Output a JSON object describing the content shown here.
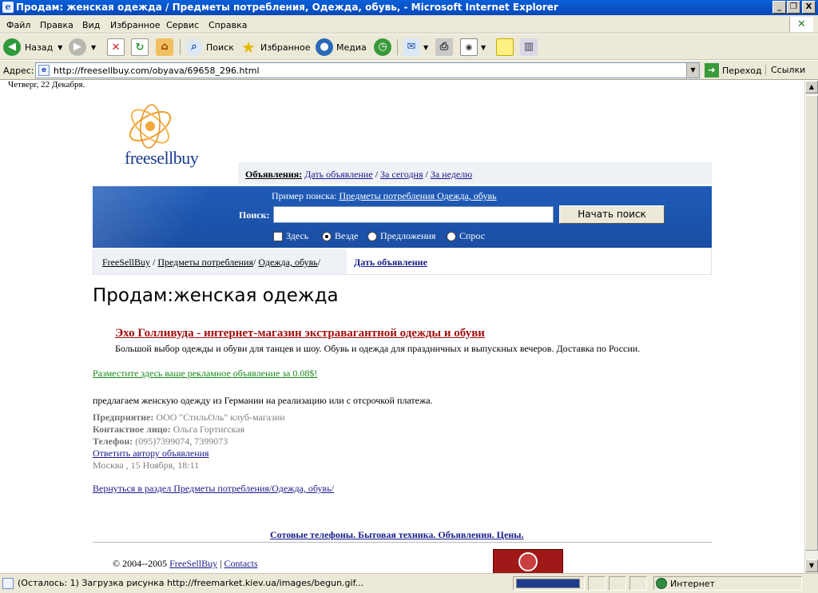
{
  "window": {
    "title": "Продам: женская одежда / Предметы потребления, Одежда, обувь, - Microsoft Internet Explorer",
    "min": "_",
    "max": "❐",
    "close": "X"
  },
  "menu": [
    "Файл",
    "Правка",
    "Вид",
    "Избранное",
    "Сервис",
    "Справка"
  ],
  "toolbar": {
    "back": "Назад",
    "search": "Поиск",
    "favorites": "Избранное",
    "media": "Медиа"
  },
  "address": {
    "label": "Адрес:",
    "url": "http://freesellbuy.com/obyava/69658_296.html",
    "go": "Переход",
    "links": "Ссылки"
  },
  "page": {
    "date": "Четверг, 22 Декабря.",
    "logo": "freesellbuy",
    "ads_bar": {
      "label": "Объявления:",
      "links": [
        "Дать объявление",
        "За сегодня",
        "За неделю"
      ],
      "sep": "/"
    },
    "search": {
      "example_label": "Пример поиска:",
      "example_link": "Предметы потребления Одежда, обувь",
      "label": "Поиск:",
      "value": "",
      "button": "Начать поиск",
      "options": [
        {
          "label": "Здесь",
          "type": "checkbox",
          "checked": false
        },
        {
          "label": "Везде",
          "type": "radio",
          "checked": true
        },
        {
          "label": "Предложения",
          "type": "radio",
          "checked": false
        },
        {
          "label": "Спрос",
          "type": "radio",
          "checked": false
        }
      ]
    },
    "breadcrumb": {
      "items": [
        "FreeSellBuy",
        "Предметы потребления",
        "Одежда, обувь"
      ],
      "give_ad": "Дать объявление"
    },
    "heading": "Продам:женская одежда",
    "ad": {
      "title": "Эхо Голливуда - интернет-магазин экстравагантной одежды и обуви",
      "text": "Большой выбор одежды и обуви для танцев и шоу. Обувь и одежда для праздничных и выпускных вечеров. Доставка по России."
    },
    "place_ad": "Разместите здесь ваше рекламное объявление за 0.08$!",
    "body": "предлагаем женскую одежду из Германии на реализацию или с отсрочкой платежа.",
    "details": {
      "company_label": "Предприятие:",
      "company": "ООО \"СтильОль\" клуб-магазин",
      "contact_label": "Контактное лицо:",
      "contact": "Ольга Гортигская",
      "phone_label": "Телефон:",
      "phone": "(095)7399074, 7399073",
      "reply": "Ответить автору объявления",
      "location_date": "Москва , 15 Ноября, 18:11"
    },
    "back_link": "Вернуться в раздел Предметы потребления/Одежда, обувь/",
    "footer_links": "Сотовые телефоны. Бытовая техника. Объявления. Цены.",
    "copyright": "© 2004--2005",
    "copyright_link": "FreeSellBuy",
    "contacts": "Contacts"
  },
  "status": {
    "text": "(Осталось: 1) Загрузка рисунка http://freemarket.kiev.ua/images/begun.gif...",
    "zone": "Интернет"
  }
}
